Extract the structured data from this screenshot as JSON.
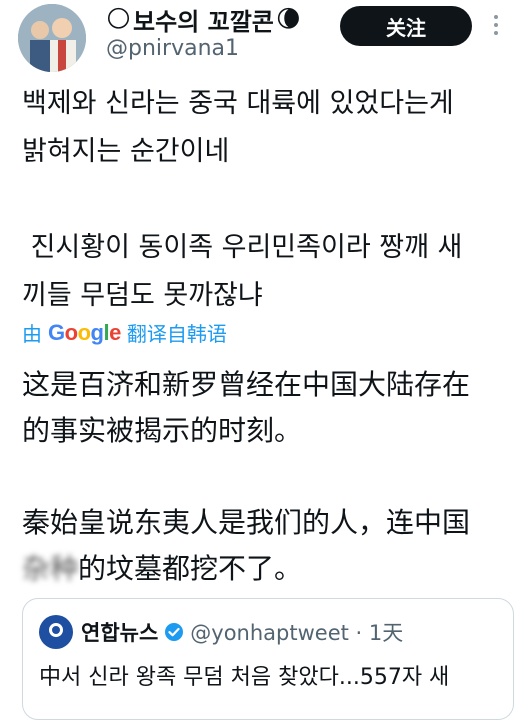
{
  "author": {
    "name": "보수의 꼬깔콘",
    "left_emoji": "🌕",
    "right_emoji": "🌘",
    "handle": "@pnirvana1",
    "follow_label": "关注"
  },
  "tweet": {
    "para1_line1": "백제와 신라는 중국 대륙에 있었다는게",
    "para1_line2": "밝혀지는 순간이네",
    "para2_line1": " 진시황이 동이족 우리민족이라 짱깨 새",
    "para2_line2": "끼들 무덤도 못까잖냐"
  },
  "translation": {
    "by": "由",
    "provider": "Google",
    "suffix": "翻译自韩语",
    "line1": "这是百济和新罗曾经在中国大陆存在",
    "line2": "的事实被揭示的时刻。",
    "line3": "秦始皇说东夷人是我们的人，连中国",
    "line4_blurred": "杂种",
    "line4_rest": "的坟墓都挖不了。"
  },
  "quote": {
    "name": "연합뉴스",
    "handle": "@yonhaptweet · 1天",
    "text": "中서 신라 왕족 무덤 처음 찾았다...557자 새"
  },
  "colors": {
    "link": "#1d9bf0",
    "muted": "#536471",
    "verified": "#1d9bf0"
  },
  "icons": {
    "more": "more-vertical-icon",
    "verified": "verified-badge-icon"
  }
}
